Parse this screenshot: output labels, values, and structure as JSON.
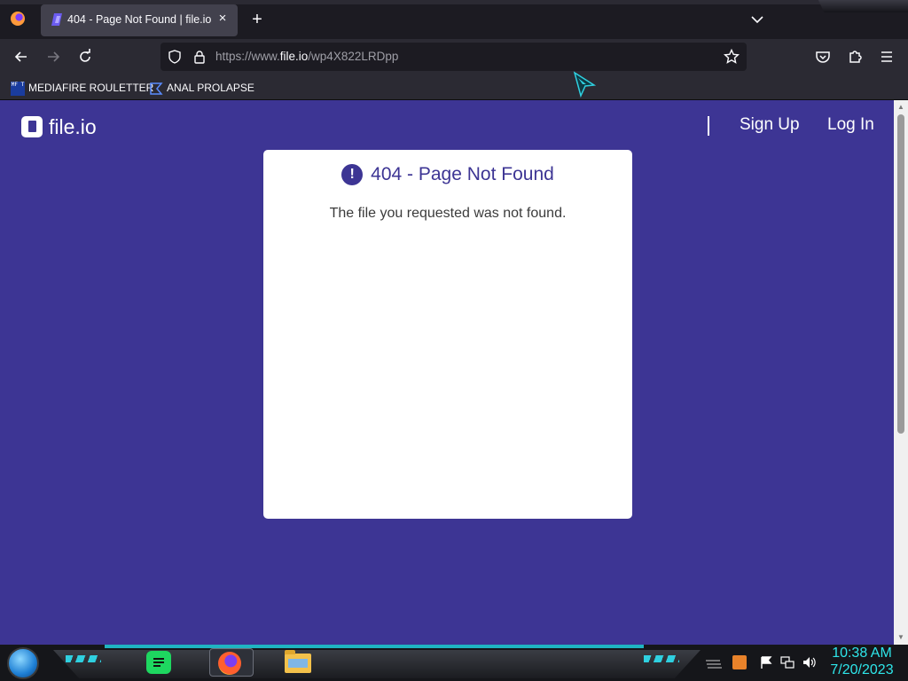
{
  "browser": {
    "tab": {
      "title": "404 - Page Not Found | file.io",
      "close": "×"
    },
    "new_tab": "+",
    "url": {
      "prefix": "https://www.",
      "domain": "file.io",
      "path": "/wp4X822LRDpp"
    },
    "bookmarks": [
      {
        "label": "MEDIAFIRE ROULETTER",
        "icon_text": "MF T"
      },
      {
        "label": "ANAL PROLAPSE"
      }
    ]
  },
  "site": {
    "logo_text": "file.io",
    "nav": {
      "signup": "Sign Up",
      "login": "Log In"
    }
  },
  "error_card": {
    "icon": "!",
    "title": "404 - Page Not Found",
    "message": "The file you requested was not found."
  },
  "taskbar": {
    "time": "10:38 AM",
    "date": "7/20/2023"
  },
  "colors": {
    "page_background": "#3d3594",
    "card_background": "#ffffff",
    "clock": "#2ee6ea",
    "taskbar_accent": "#1fb4c2"
  }
}
